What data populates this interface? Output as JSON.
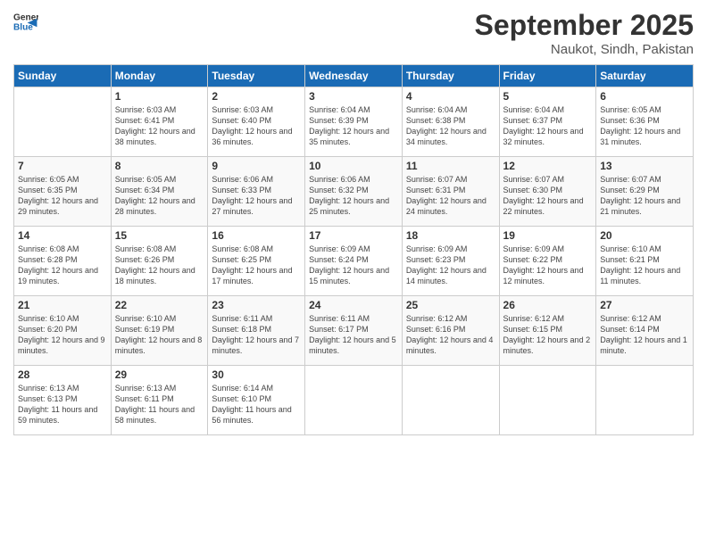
{
  "header": {
    "logo": {
      "general": "General",
      "blue": "Blue"
    },
    "title": "September 2025",
    "location": "Naukot, Sindh, Pakistan"
  },
  "weekdays": [
    "Sunday",
    "Monday",
    "Tuesday",
    "Wednesday",
    "Thursday",
    "Friday",
    "Saturday"
  ],
  "weeks": [
    [
      {
        "day": "",
        "sunrise": "",
        "sunset": "",
        "daylight": ""
      },
      {
        "day": "1",
        "sunrise": "Sunrise: 6:03 AM",
        "sunset": "Sunset: 6:41 PM",
        "daylight": "Daylight: 12 hours and 38 minutes."
      },
      {
        "day": "2",
        "sunrise": "Sunrise: 6:03 AM",
        "sunset": "Sunset: 6:40 PM",
        "daylight": "Daylight: 12 hours and 36 minutes."
      },
      {
        "day": "3",
        "sunrise": "Sunrise: 6:04 AM",
        "sunset": "Sunset: 6:39 PM",
        "daylight": "Daylight: 12 hours and 35 minutes."
      },
      {
        "day": "4",
        "sunrise": "Sunrise: 6:04 AM",
        "sunset": "Sunset: 6:38 PM",
        "daylight": "Daylight: 12 hours and 34 minutes."
      },
      {
        "day": "5",
        "sunrise": "Sunrise: 6:04 AM",
        "sunset": "Sunset: 6:37 PM",
        "daylight": "Daylight: 12 hours and 32 minutes."
      },
      {
        "day": "6",
        "sunrise": "Sunrise: 6:05 AM",
        "sunset": "Sunset: 6:36 PM",
        "daylight": "Daylight: 12 hours and 31 minutes."
      }
    ],
    [
      {
        "day": "7",
        "sunrise": "Sunrise: 6:05 AM",
        "sunset": "Sunset: 6:35 PM",
        "daylight": "Daylight: 12 hours and 29 minutes."
      },
      {
        "day": "8",
        "sunrise": "Sunrise: 6:05 AM",
        "sunset": "Sunset: 6:34 PM",
        "daylight": "Daylight: 12 hours and 28 minutes."
      },
      {
        "day": "9",
        "sunrise": "Sunrise: 6:06 AM",
        "sunset": "Sunset: 6:33 PM",
        "daylight": "Daylight: 12 hours and 27 minutes."
      },
      {
        "day": "10",
        "sunrise": "Sunrise: 6:06 AM",
        "sunset": "Sunset: 6:32 PM",
        "daylight": "Daylight: 12 hours and 25 minutes."
      },
      {
        "day": "11",
        "sunrise": "Sunrise: 6:07 AM",
        "sunset": "Sunset: 6:31 PM",
        "daylight": "Daylight: 12 hours and 24 minutes."
      },
      {
        "day": "12",
        "sunrise": "Sunrise: 6:07 AM",
        "sunset": "Sunset: 6:30 PM",
        "daylight": "Daylight: 12 hours and 22 minutes."
      },
      {
        "day": "13",
        "sunrise": "Sunrise: 6:07 AM",
        "sunset": "Sunset: 6:29 PM",
        "daylight": "Daylight: 12 hours and 21 minutes."
      }
    ],
    [
      {
        "day": "14",
        "sunrise": "Sunrise: 6:08 AM",
        "sunset": "Sunset: 6:28 PM",
        "daylight": "Daylight: 12 hours and 19 minutes."
      },
      {
        "day": "15",
        "sunrise": "Sunrise: 6:08 AM",
        "sunset": "Sunset: 6:26 PM",
        "daylight": "Daylight: 12 hours and 18 minutes."
      },
      {
        "day": "16",
        "sunrise": "Sunrise: 6:08 AM",
        "sunset": "Sunset: 6:25 PM",
        "daylight": "Daylight: 12 hours and 17 minutes."
      },
      {
        "day": "17",
        "sunrise": "Sunrise: 6:09 AM",
        "sunset": "Sunset: 6:24 PM",
        "daylight": "Daylight: 12 hours and 15 minutes."
      },
      {
        "day": "18",
        "sunrise": "Sunrise: 6:09 AM",
        "sunset": "Sunset: 6:23 PM",
        "daylight": "Daylight: 12 hours and 14 minutes."
      },
      {
        "day": "19",
        "sunrise": "Sunrise: 6:09 AM",
        "sunset": "Sunset: 6:22 PM",
        "daylight": "Daylight: 12 hours and 12 minutes."
      },
      {
        "day": "20",
        "sunrise": "Sunrise: 6:10 AM",
        "sunset": "Sunset: 6:21 PM",
        "daylight": "Daylight: 12 hours and 11 minutes."
      }
    ],
    [
      {
        "day": "21",
        "sunrise": "Sunrise: 6:10 AM",
        "sunset": "Sunset: 6:20 PM",
        "daylight": "Daylight: 12 hours and 9 minutes."
      },
      {
        "day": "22",
        "sunrise": "Sunrise: 6:10 AM",
        "sunset": "Sunset: 6:19 PM",
        "daylight": "Daylight: 12 hours and 8 minutes."
      },
      {
        "day": "23",
        "sunrise": "Sunrise: 6:11 AM",
        "sunset": "Sunset: 6:18 PM",
        "daylight": "Daylight: 12 hours and 7 minutes."
      },
      {
        "day": "24",
        "sunrise": "Sunrise: 6:11 AM",
        "sunset": "Sunset: 6:17 PM",
        "daylight": "Daylight: 12 hours and 5 minutes."
      },
      {
        "day": "25",
        "sunrise": "Sunrise: 6:12 AM",
        "sunset": "Sunset: 6:16 PM",
        "daylight": "Daylight: 12 hours and 4 minutes."
      },
      {
        "day": "26",
        "sunrise": "Sunrise: 6:12 AM",
        "sunset": "Sunset: 6:15 PM",
        "daylight": "Daylight: 12 hours and 2 minutes."
      },
      {
        "day": "27",
        "sunrise": "Sunrise: 6:12 AM",
        "sunset": "Sunset: 6:14 PM",
        "daylight": "Daylight: 12 hours and 1 minute."
      }
    ],
    [
      {
        "day": "28",
        "sunrise": "Sunrise: 6:13 AM",
        "sunset": "Sunset: 6:13 PM",
        "daylight": "Daylight: 11 hours and 59 minutes."
      },
      {
        "day": "29",
        "sunrise": "Sunrise: 6:13 AM",
        "sunset": "Sunset: 6:11 PM",
        "daylight": "Daylight: 11 hours and 58 minutes."
      },
      {
        "day": "30",
        "sunrise": "Sunrise: 6:14 AM",
        "sunset": "Sunset: 6:10 PM",
        "daylight": "Daylight: 11 hours and 56 minutes."
      },
      {
        "day": "",
        "sunrise": "",
        "sunset": "",
        "daylight": ""
      },
      {
        "day": "",
        "sunrise": "",
        "sunset": "",
        "daylight": ""
      },
      {
        "day": "",
        "sunrise": "",
        "sunset": "",
        "daylight": ""
      },
      {
        "day": "",
        "sunrise": "",
        "sunset": "",
        "daylight": ""
      }
    ]
  ]
}
